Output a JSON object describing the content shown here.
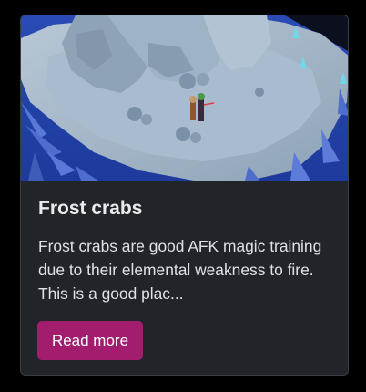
{
  "card": {
    "title": "Frost crabs",
    "excerpt": "Frost crabs are good AFK magic training due to their elemental weakness to fire. This is a good plac...",
    "button_label": "Read more",
    "image_description_icon": "game-scene-image",
    "accent_color": "#a31d6f",
    "background_color": "#212429"
  }
}
